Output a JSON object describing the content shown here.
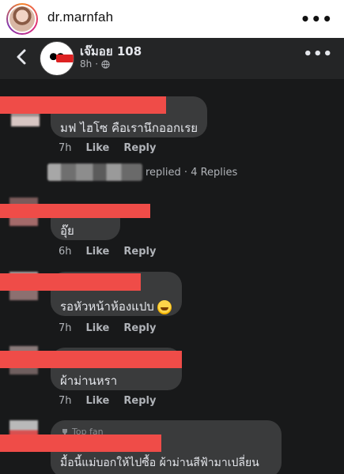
{
  "instagram": {
    "username": "dr.marnfah",
    "more_icon": "more-horizontal-icon"
  },
  "post_header": {
    "page_name": "เจ๊มอย 108",
    "time": "8h",
    "privacy_icon": "globe-icon",
    "back_icon": "chevron-left-icon",
    "more_icon": "more-horizontal-icon"
  },
  "comments": [
    {
      "text": "มฟ ไฮโซ  คือเรานึกออกเรย",
      "time": "7h",
      "like": "Like",
      "reply": "Reply"
    },
    {
      "text": "อุ๊ย",
      "time": "6h",
      "like": "Like",
      "reply": "Reply"
    },
    {
      "text": "รอหัวหน้าห้องแปบ",
      "time": "7h",
      "like": "Like",
      "reply": "Reply"
    },
    {
      "text": "ผ้าม่านหรา",
      "time": "7h",
      "like": "Like",
      "reply": "Reply"
    },
    {
      "badge": "Top fan",
      "text": "มื้อนี้แม่บอกให้ไปซื้อ ผ้าม่านสีฟ้ามาเปลี่ยน"
    }
  ],
  "replies": {
    "label": "replied",
    "count": "4 Replies"
  },
  "colors": {
    "redaction": "#ef4c48",
    "bubble": "#3a3b3c",
    "background": "#18191a"
  }
}
